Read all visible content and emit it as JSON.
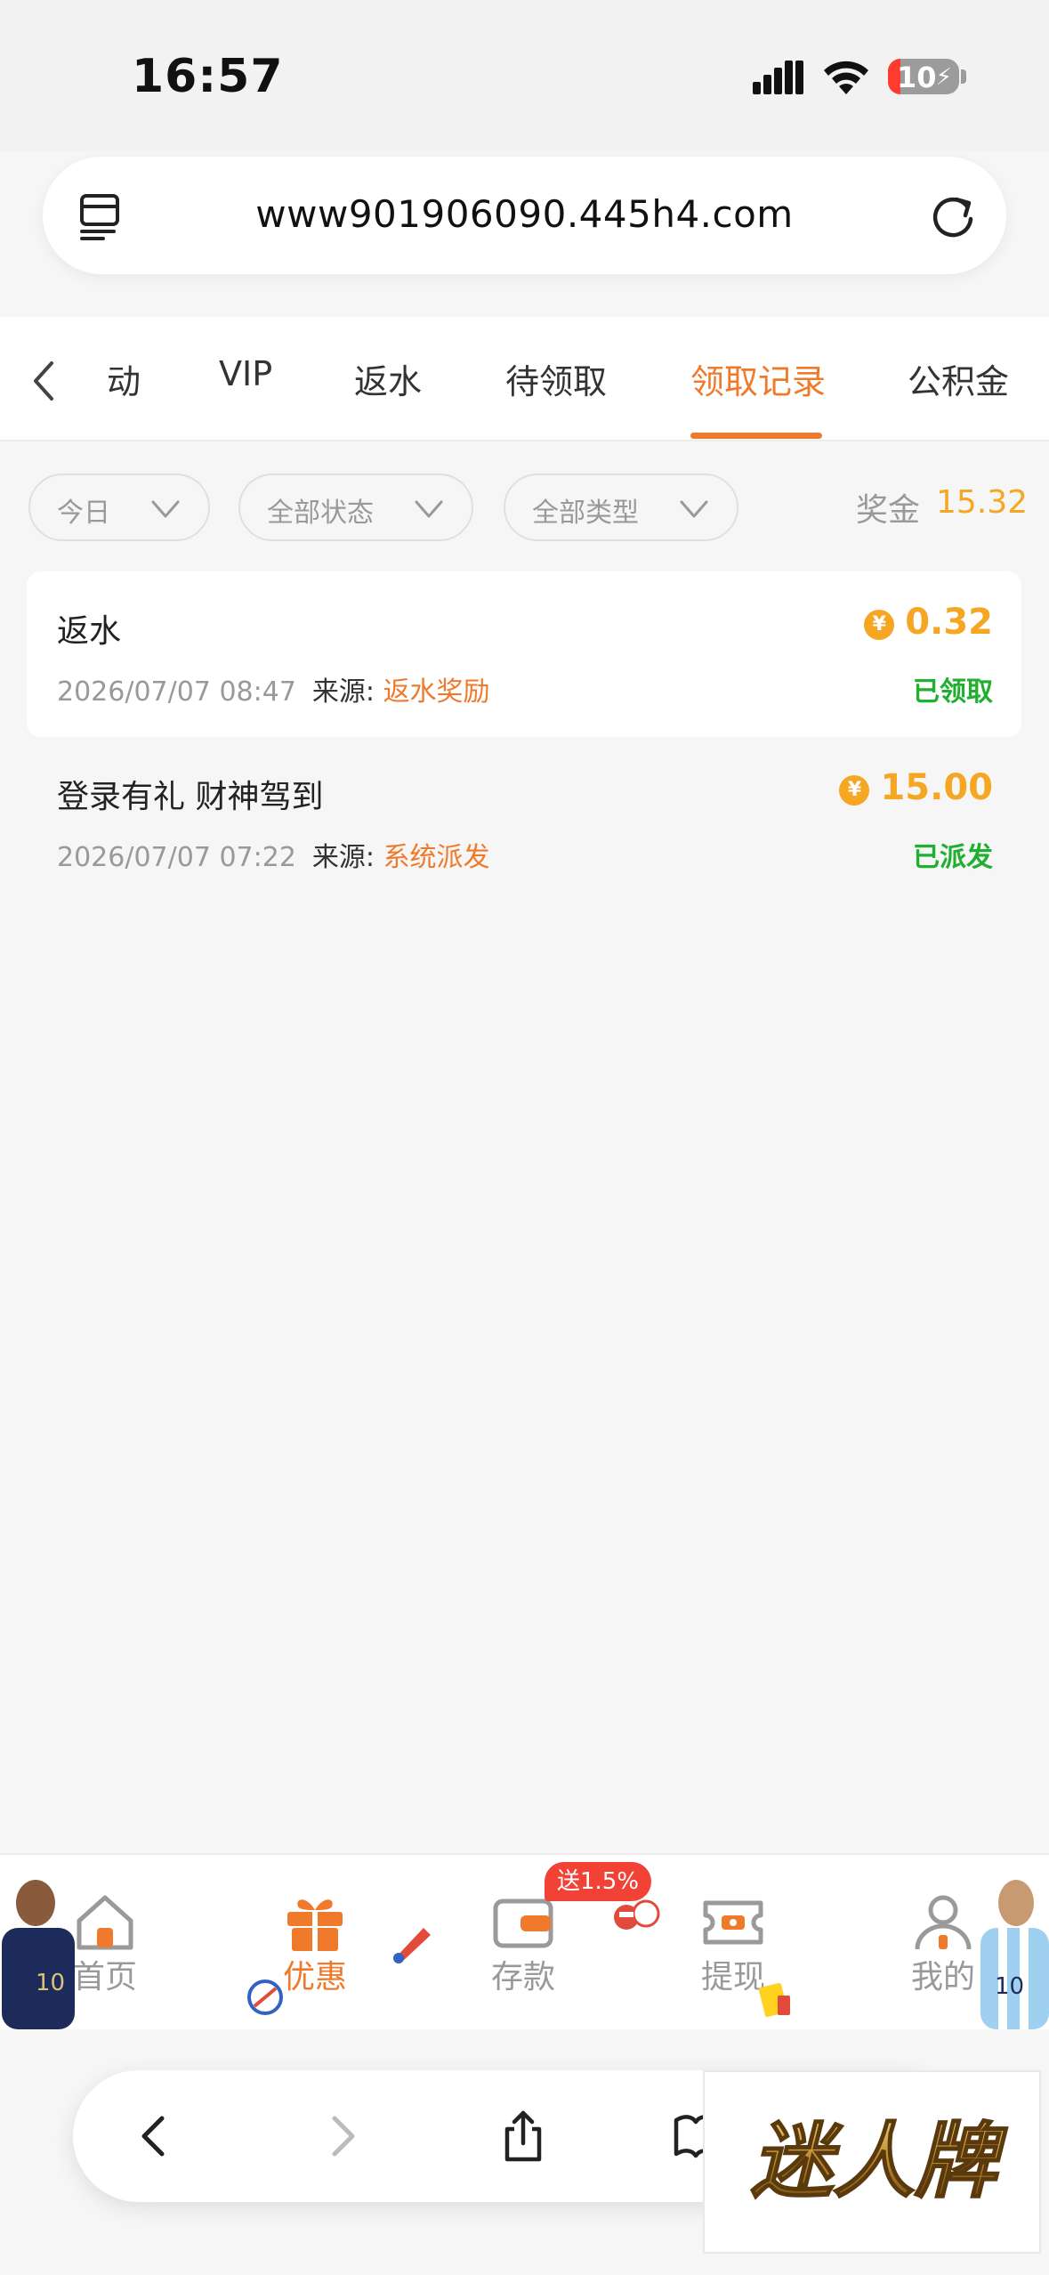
{
  "status_bar": {
    "time": "16:57",
    "battery": "10"
  },
  "browser": {
    "url": "www901906090.445h4.com"
  },
  "tabs": [
    {
      "label": "动"
    },
    {
      "label": "VIP"
    },
    {
      "label": "返水"
    },
    {
      "label": "待领取"
    },
    {
      "label": "领取记录",
      "active": true
    },
    {
      "label": "公积金"
    }
  ],
  "filters": {
    "date": "今日",
    "status": "全部状态",
    "type": "全部类型"
  },
  "bonus": {
    "label": "奖金",
    "value": "15.32"
  },
  "source_label": "来源:",
  "records": [
    {
      "title": "返水",
      "datetime": "2026/07/07 08:47",
      "source": "返水奖励",
      "amount": "0.32",
      "status": "已领取"
    },
    {
      "title": "登录有礼 财神驾到",
      "datetime": "2026/07/07 07:22",
      "source": "系统派发",
      "amount": "15.00",
      "status": "已派发"
    }
  ],
  "coin_symbol": "¥",
  "bottom_nav": {
    "items": [
      {
        "label": "首页"
      },
      {
        "label": "优惠",
        "active": true
      },
      {
        "label": "存款"
      },
      {
        "label": "提现"
      },
      {
        "label": "我的"
      }
    ],
    "deposit_badge": "送1.5%"
  },
  "watermark": {
    "text": "迷人牌"
  },
  "colors": {
    "accent": "#f07a2c",
    "gold": "#f5a623",
    "success": "#1fb02f",
    "badge": "#f24236"
  }
}
